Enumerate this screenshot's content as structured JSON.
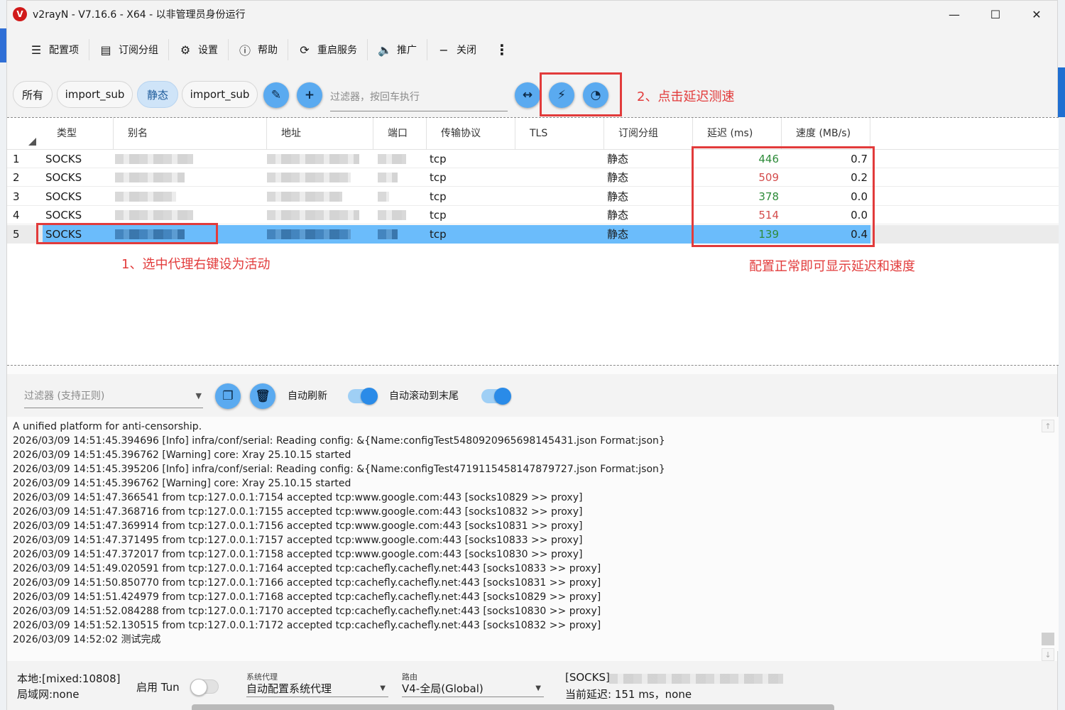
{
  "window": {
    "title": "v2rayN - V7.16.6 - X64 - 以非管理员身份运行",
    "logo_icon": "v2rayn-logo-icon"
  },
  "toolbar": {
    "items": [
      {
        "label": "配置项",
        "icon": "server-list-icon"
      },
      {
        "label": "订阅分组",
        "icon": "subscription-icon"
      },
      {
        "label": "设置",
        "icon": "gear-icon"
      },
      {
        "label": "帮助",
        "icon": "help-icon"
      },
      {
        "label": "重启服务",
        "icon": "restart-icon"
      },
      {
        "label": "推广",
        "icon": "megaphone-icon"
      },
      {
        "label": "关闭",
        "icon": "minus-icon"
      }
    ]
  },
  "groups": {
    "chips": [
      "所有",
      "import_sub",
      "静态",
      "import_sub"
    ],
    "active_index": 2,
    "filter_placeholder": "过滤器，按回车执行"
  },
  "annotations": {
    "step1": "1、选中代理右键设为活动",
    "step2": "2、点击延迟测速",
    "note": "配置正常即可显示延迟和速度",
    "color": "#e23b3b"
  },
  "table": {
    "headers": [
      "类型",
      "别名",
      "地址",
      "端口",
      "传输协议",
      "TLS",
      "订阅分组",
      "延迟 (ms)",
      "速度 (MB/s)"
    ],
    "rows": [
      {
        "idx": "1",
        "type": "SOCKS",
        "network": "tcp",
        "tls": "",
        "group": "静态",
        "delay": "446",
        "speed": "0.7",
        "delay_color": "green"
      },
      {
        "idx": "2",
        "type": "SOCKS",
        "network": "tcp",
        "tls": "",
        "group": "静态",
        "delay": "509",
        "speed": "0.2",
        "delay_color": "red"
      },
      {
        "idx": "3",
        "type": "SOCKS",
        "network": "tcp",
        "tls": "",
        "group": "静态",
        "delay": "378",
        "speed": "0.0",
        "delay_color": "green"
      },
      {
        "idx": "4",
        "type": "SOCKS",
        "network": "tcp",
        "tls": "",
        "group": "静态",
        "delay": "514",
        "speed": "0.0",
        "delay_color": "red"
      },
      {
        "idx": "5",
        "type": "SOCKS",
        "network": "tcp",
        "tls": "",
        "group": "静态",
        "delay": "139",
        "speed": "0.4",
        "delay_color": "green"
      }
    ],
    "selected_index": 4
  },
  "logbar": {
    "filter_placeholder": "过滤器 (支持正则)",
    "auto_refresh_label": "自动刷新",
    "auto_scroll_label": "自动滚动到末尾"
  },
  "log": {
    "lines": [
      "A unified platform for anti-censorship.",
      "2026/03/09 14:51:45.394696 [Info] infra/conf/serial: Reading config: &{Name:configTest5480920965698145431.json Format:json}",
      "2026/03/09 14:51:45.396762 [Warning] core: Xray 25.10.15 started",
      "2026/03/09 14:51:45.395206 [Info] infra/conf/serial: Reading config: &{Name:configTest4719115458147879727.json Format:json}",
      "2026/03/09 14:51:45.396762 [Warning] core: Xray 25.10.15 started",
      "2026/03/09 14:51:47.366541 from tcp:127.0.0.1:7154 accepted tcp:www.google.com:443 [socks10829 >> proxy]",
      "2026/03/09 14:51:47.368716 from tcp:127.0.0.1:7155 accepted tcp:www.google.com:443 [socks10832 >> proxy]",
      "2026/03/09 14:51:47.369914 from tcp:127.0.0.1:7156 accepted tcp:www.google.com:443 [socks10831 >> proxy]",
      "2026/03/09 14:51:47.371495 from tcp:127.0.0.1:7157 accepted tcp:www.google.com:443 [socks10833 >> proxy]",
      "2026/03/09 14:51:47.372017 from tcp:127.0.0.1:7158 accepted tcp:www.google.com:443 [socks10830 >> proxy]",
      "2026/03/09 14:51:49.020591 from tcp:127.0.0.1:7164 accepted tcp:cachefly.cachefly.net:443 [socks10833 >> proxy]",
      "2026/03/09 14:51:50.850770 from tcp:127.0.0.1:7166 accepted tcp:cachefly.cachefly.net:443 [socks10831 >> proxy]",
      "2026/03/09 14:51:51.424979 from tcp:127.0.0.1:7168 accepted tcp:cachefly.cachefly.net:443 [socks10829 >> proxy]",
      "2026/03/09 14:51:52.084288 from tcp:127.0.0.1:7170 accepted tcp:cachefly.cachefly.net:443 [socks10830 >> proxy]",
      "2026/03/09 14:51:52.130515 from tcp:127.0.0.1:7172 accepted tcp:cachefly.cachefly.net:443 [socks10832 >> proxy]",
      "2026/03/09 14:52:02 测试完成"
    ]
  },
  "status": {
    "local": "本地:[mixed:10808]",
    "lan": "局域网:none",
    "tun_label": "启用 Tun",
    "sysproxy_caption": "系统代理",
    "sysproxy_value": "自动配置系统代理",
    "routing_caption": "路由",
    "routing_value": "V4-全局(Global)",
    "active_prefix": "[SOCKS]",
    "current_delay": "当前延迟: 151 ms，none"
  }
}
